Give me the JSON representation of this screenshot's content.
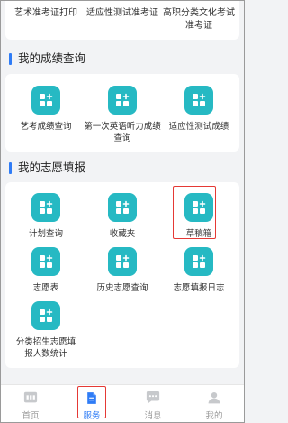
{
  "top_row": {
    "items": [
      {
        "label": "艺术准考证打印"
      },
      {
        "label": "适应性测试准考证"
      },
      {
        "label": "高职分类文化考试准考证"
      }
    ]
  },
  "scores": {
    "title": "我的成绩查询",
    "items": [
      {
        "label": "艺考成绩查询",
        "icon": "app-grid-icon"
      },
      {
        "label": "第一次英语听力成绩查询",
        "icon": "app-grid-icon"
      },
      {
        "label": "适应性测试成绩",
        "icon": "app-grid-icon"
      }
    ]
  },
  "volunteer": {
    "title": "我的志愿填报",
    "items": [
      {
        "label": "计划查询",
        "icon": "app-grid-icon"
      },
      {
        "label": "收藏夹",
        "icon": "app-grid-icon"
      },
      {
        "label": "草稿箱",
        "icon": "app-grid-icon"
      },
      {
        "label": "志愿表",
        "icon": "app-grid-icon"
      },
      {
        "label": "历史志愿查询",
        "icon": "app-grid-icon"
      },
      {
        "label": "志愿填报日志",
        "icon": "app-grid-icon"
      },
      {
        "label": "分类招生志愿填报人数统计",
        "icon": "app-grid-icon"
      }
    ]
  },
  "tabbar": {
    "tabs": [
      {
        "label": "首页",
        "icon": "home-icon",
        "active": false
      },
      {
        "label": "服务",
        "icon": "document-icon",
        "active": true
      },
      {
        "label": "消息",
        "icon": "chat-icon",
        "active": false
      },
      {
        "label": "我的",
        "icon": "user-icon",
        "active": false
      }
    ]
  },
  "colors": {
    "accent": "#2f7cf6",
    "icon_tile": "#26b9c3",
    "highlight": "#e53935",
    "background": "#f2f3f5"
  }
}
